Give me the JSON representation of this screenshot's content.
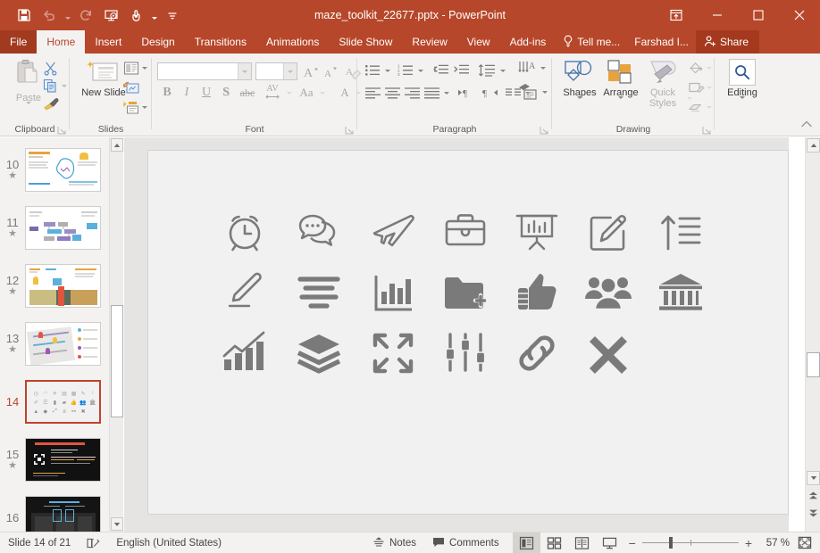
{
  "titlebar": {
    "document_title": "maze_toolkit_22677.pptx - PowerPoint",
    "quick_access": [
      {
        "name": "save-icon",
        "label": "Save",
        "disabled": false
      },
      {
        "name": "undo-icon",
        "label": "Undo",
        "disabled": true
      },
      {
        "name": "redo-icon",
        "label": "Redo",
        "disabled": true
      },
      {
        "name": "start-presentation-icon",
        "label": "Start From Beginning",
        "disabled": false
      },
      {
        "name": "touch-mouse-mode-icon",
        "label": "Touch/Mouse Mode",
        "disabled": false
      },
      {
        "name": "customize-quick-access-icon",
        "label": "Customize Quick Access Toolbar",
        "disabled": false
      }
    ],
    "window_controls": [
      {
        "name": "ribbon-display-options-icon",
        "label": "Ribbon Display Options"
      },
      {
        "name": "minimize-icon",
        "label": "Minimize"
      },
      {
        "name": "maximize-icon",
        "label": "Maximize"
      },
      {
        "name": "close-icon",
        "label": "Close"
      }
    ],
    "accent_color": "#b7472a",
    "file_tab_color": "#a23a1f"
  },
  "tabs": [
    {
      "label": "File",
      "active": false,
      "kind": "file"
    },
    {
      "label": "Home",
      "active": true,
      "kind": "normal"
    },
    {
      "label": "Insert",
      "active": false,
      "kind": "normal"
    },
    {
      "label": "Design",
      "active": false,
      "kind": "normal"
    },
    {
      "label": "Transitions",
      "active": false,
      "kind": "normal"
    },
    {
      "label": "Animations",
      "active": false,
      "kind": "normal"
    },
    {
      "label": "Slide Show",
      "active": false,
      "kind": "normal"
    },
    {
      "label": "Review",
      "active": false,
      "kind": "normal"
    },
    {
      "label": "View",
      "active": false,
      "kind": "normal"
    },
    {
      "label": "Add-ins",
      "active": false,
      "kind": "normal"
    }
  ],
  "tellme": {
    "label": "Tell me...",
    "icon": "lightbulb-icon"
  },
  "account": {
    "label": "Farshad I..."
  },
  "share": {
    "label": "Share",
    "icon": "share-person-icon"
  },
  "ribbon": {
    "groups": [
      {
        "name": "clipboard",
        "label": "Clipboard"
      },
      {
        "name": "slides",
        "label": "Slides"
      },
      {
        "name": "font",
        "label": "Font"
      },
      {
        "name": "paragraph",
        "label": "Paragraph"
      },
      {
        "name": "drawing",
        "label": "Drawing"
      },
      {
        "name": "editing",
        "label": "Editing"
      }
    ],
    "clipboard": {
      "paste_label": "Paste",
      "cut_label": "Cut",
      "copy_label": "Copy",
      "format_painter_label": "Format Painter"
    },
    "slides": {
      "new_slide_label": "New Slide",
      "layout_label": "Layout",
      "reset_label": "Reset",
      "section_label": "Section"
    },
    "font": {
      "font_name_value": "",
      "font_name_placeholder": "",
      "font_size_value": "",
      "increase_size_label": "Increase Font Size",
      "decrease_size_label": "Decrease Font Size",
      "clear_formatting_label": "Clear All Formatting",
      "bold_label": "B",
      "italic_label": "I",
      "underline_label": "U",
      "shadow_label": "S",
      "strikethrough_label": "abc",
      "spacing_label": "AV",
      "change_case_label": "Aa",
      "font_color_label": "A"
    },
    "paragraph": {
      "bullets_label": "Bullets",
      "numbering_label": "Numbering",
      "decrease_indent_label": "Decrease Indent",
      "increase_indent_label": "Increase Indent",
      "line_spacing_label": "Line Spacing",
      "text_direction_label": "Text Direction",
      "align_text_label": "Align Text",
      "smartart_label": "Convert to SmartArt",
      "align_left_label": "Align Left",
      "center_label": "Center",
      "align_right_label": "Align Right",
      "justify_label": "Justify",
      "ltr_label": "Left-to-Right",
      "rtl_label": "Right-to-Left",
      "columns_label": "Columns"
    },
    "drawing": {
      "shapes_label": "Shapes",
      "arrange_label": "Arrange",
      "quick_styles_label": "Quick Styles",
      "shape_fill_label": "Shape Fill",
      "shape_outline_label": "Shape Outline",
      "shape_effects_label": "Shape Effects"
    },
    "editing": {
      "editing_label": "Editing"
    },
    "collapse_label": "Collapse the Ribbon"
  },
  "thumbnails": {
    "slides": [
      {
        "number": "10",
        "starred": true,
        "selected": false,
        "style": "brain"
      },
      {
        "number": "11",
        "starred": true,
        "selected": false,
        "style": "flowchart"
      },
      {
        "number": "12",
        "starred": true,
        "selected": false,
        "style": "roadmap"
      },
      {
        "number": "13",
        "starred": true,
        "selected": false,
        "style": "citymap"
      },
      {
        "number": "14",
        "starred": false,
        "selected": true,
        "style": "icons"
      },
      {
        "number": "15",
        "starred": true,
        "selected": false,
        "style": "darktext"
      },
      {
        "number": "16",
        "starred": false,
        "selected": false,
        "style": "darkchart"
      }
    ],
    "star_glyph": "★",
    "scroll_up_label": "Scroll Up",
    "scroll_down_label": "Scroll Down"
  },
  "slide_canvas": {
    "zoom_percent": "57 %",
    "icons": [
      {
        "name": "alarm-clock-icon",
        "label": "Alarm Clock",
        "row": 0,
        "col": 0
      },
      {
        "name": "chat-bubbles-icon",
        "label": "Chat Bubbles",
        "row": 0,
        "col": 1
      },
      {
        "name": "airplane-icon",
        "label": "Airplane",
        "row": 0,
        "col": 2
      },
      {
        "name": "briefcase-icon",
        "label": "Briefcase",
        "row": 0,
        "col": 3
      },
      {
        "name": "presentation-chart-icon",
        "label": "Presentation Board",
        "row": 0,
        "col": 4
      },
      {
        "name": "edit-square-icon",
        "label": "Edit",
        "row": 0,
        "col": 5
      },
      {
        "name": "sort-ascending-icon",
        "label": "Sort Ascending",
        "row": 0,
        "col": 6
      },
      {
        "name": "pencil-icon",
        "label": "Pencil",
        "row": 1,
        "col": 0
      },
      {
        "name": "align-center-icon",
        "label": "Align Center",
        "row": 1,
        "col": 1
      },
      {
        "name": "bar-chart-icon",
        "label": "Bar Chart",
        "row": 1,
        "col": 2
      },
      {
        "name": "folder-add-icon",
        "label": "Add Folder",
        "row": 1,
        "col": 3
      },
      {
        "name": "thumbs-up-icon",
        "label": "Thumbs Up",
        "row": 1,
        "col": 4
      },
      {
        "name": "people-group-icon",
        "label": "People Group",
        "row": 1,
        "col": 5
      },
      {
        "name": "bank-building-icon",
        "label": "Bank",
        "row": 1,
        "col": 6
      },
      {
        "name": "growth-chart-icon",
        "label": "Growth Chart",
        "row": 2,
        "col": 0
      },
      {
        "name": "layers-icon",
        "label": "Layers",
        "row": 2,
        "col": 1
      },
      {
        "name": "expand-arrows-icon",
        "label": "Expand",
        "row": 2,
        "col": 2
      },
      {
        "name": "sliders-icon",
        "label": "Sliders",
        "row": 2,
        "col": 3
      },
      {
        "name": "link-icon",
        "label": "Link",
        "row": 2,
        "col": 4
      },
      {
        "name": "close-x-icon",
        "label": "Close X",
        "row": 2,
        "col": 5
      }
    ],
    "icon_color": "#7a7a7a",
    "background_color": "#f1f1f1"
  },
  "statusbar": {
    "slide_position": "Slide 14 of 21",
    "accessibility_icon": "accessibility-checker-icon",
    "language": "English (United States)",
    "notes_label": "Notes",
    "comments_label": "Comments",
    "views": [
      {
        "name": "normal-view-button",
        "label": "Normal",
        "active": true
      },
      {
        "name": "slide-sorter-view-button",
        "label": "Slide Sorter",
        "active": false
      },
      {
        "name": "reading-view-button",
        "label": "Reading View",
        "active": false
      },
      {
        "name": "slideshow-view-button",
        "label": "Slide Show",
        "active": false
      }
    ],
    "zoom_out_label": "−",
    "zoom_in_label": "+",
    "zoom_value": "57 %",
    "fit_slide_label": "Fit slide to current window"
  }
}
